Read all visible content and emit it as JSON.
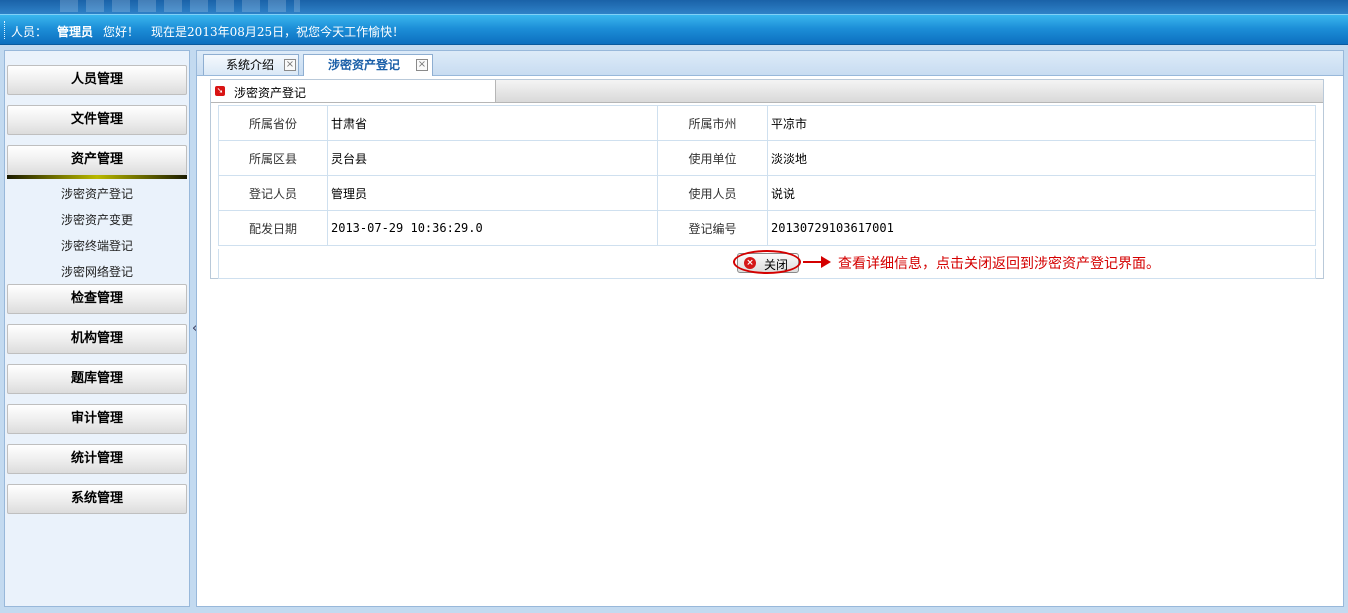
{
  "status": {
    "user_label": "人员：",
    "role": "管理员",
    "greeting": "您好！",
    "message": "现在是2013年08月25日，祝您今天工作愉快！"
  },
  "sidebar": {
    "menu": [
      {
        "label": "人员管理"
      },
      {
        "label": "文件管理"
      },
      {
        "label": "资产管理"
      },
      {
        "label": "检查管理"
      },
      {
        "label": "机构管理"
      },
      {
        "label": "题库管理"
      },
      {
        "label": "审计管理"
      },
      {
        "label": "统计管理"
      },
      {
        "label": "系统管理"
      }
    ],
    "active_index": 2,
    "submenu": [
      {
        "label": "涉密资产登记"
      },
      {
        "label": "涉密资产变更"
      },
      {
        "label": "涉密终端登记"
      },
      {
        "label": "涉密网络登记"
      }
    ],
    "collapse_glyph": "«"
  },
  "tabs": [
    {
      "label": "系统介绍"
    },
    {
      "label": "涉密资产登记"
    }
  ],
  "panel": {
    "title": "涉密资产登记",
    "rows": [
      {
        "l1": "所属省份",
        "v1": "甘肃省",
        "l2": "所属市州",
        "v2": "平凉市"
      },
      {
        "l1": "所属区县",
        "v1": "灵台县",
        "l2": "使用单位",
        "v2": "淡淡地"
      },
      {
        "l1": "登记人员",
        "v1": "管理员",
        "l2": "使用人员",
        "v2": "说说"
      },
      {
        "l1": "配发日期",
        "v1": "2013-07-29 10:36:29.0",
        "l2": "登记编号",
        "v2": "20130729103617001"
      }
    ],
    "close_button": "关闭",
    "close_icon": "x-circle-icon"
  },
  "annotation": {
    "text": "查看详细信息，点击关闭返回到涉密资产登记界面。",
    "color": "#d40000"
  }
}
